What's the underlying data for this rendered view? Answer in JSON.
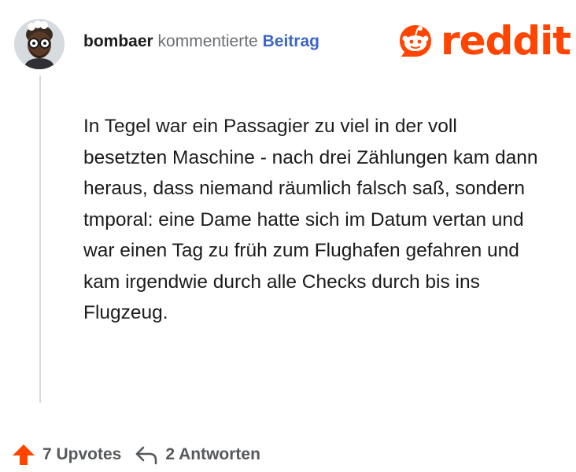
{
  "comment": {
    "username": "bombaer",
    "action_text": "kommentierte",
    "post_link": "Beitrag",
    "body": "In Tegel war ein Passagier zu viel in der voll besetzten Maschine - nach drei Zählungen kam dann heraus, dass niemand räumlich falsch saß, sondern tmporal: eine Dame hatte sich im Datum vertan und war einen Tag zu früh zum Flughafen gefahren und kam irgendwie durch alle Checks durch bis ins Flugzeug."
  },
  "brand": {
    "name": "reddit",
    "color": "#ff4500"
  },
  "footer": {
    "upvotes": "7 Upvotes",
    "replies": "2 Antworten"
  },
  "icons": {
    "avatar": "avatar",
    "upvote": "upvote-arrow-icon",
    "reply": "reply-arrow-icon"
  }
}
